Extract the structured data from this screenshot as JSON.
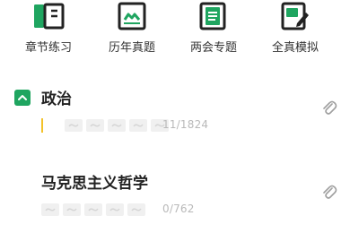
{
  "nav": {
    "items": [
      {
        "label": "章节练习",
        "icon": "book-icon"
      },
      {
        "label": "历年真题",
        "icon": "exam-paper-icon"
      },
      {
        "label": "两会专题",
        "icon": "document-stack-icon"
      },
      {
        "label": "全真模拟",
        "icon": "edit-paper-icon"
      }
    ]
  },
  "sections": [
    {
      "title": "政治",
      "count": "11/1824",
      "expanded": true,
      "stars_total": 5,
      "progress_fraction": 0.006
    },
    {
      "title": "马克思主义哲学",
      "count": "0/762",
      "stars_total": 5,
      "progress_fraction": 0
    }
  ],
  "colors": {
    "accent": "#1fa560",
    "icon_bg": "#222222",
    "progress": "#f3c22a",
    "muted": "#b9b9b9"
  }
}
